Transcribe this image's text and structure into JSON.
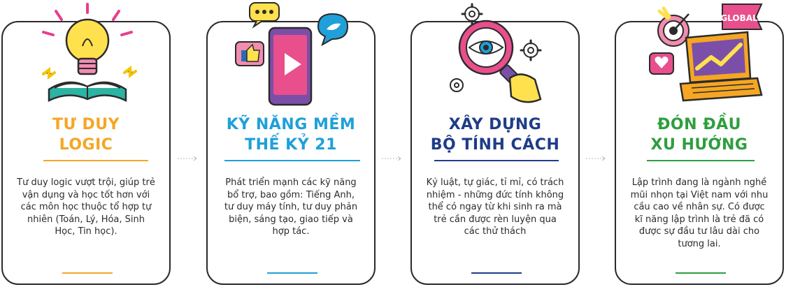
{
  "cards": [
    {
      "title_lines": [
        "TƯ DUY",
        "LOGIC"
      ],
      "description": "Tư duy logic vượt trội, giúp trẻ vận dụng và học tốt hơn với các môn học thuộc tổ hợp tự nhiên (Toán, Lý, Hóa, Sinh Học, Tin học).",
      "title_color": "#F5A623",
      "accent_color": "#F5A623",
      "icon": "lightbulb-book-icon"
    },
    {
      "title_lines": [
        "KỸ NĂNG MỀM",
        "THẾ KỶ 21"
      ],
      "description": "Phát triển mạnh các kỹ năng bổ trợ, bao gồm: Tiếng Anh, tư duy máy tính, tư duy phản biện, sáng tạo, giao tiếp và hợp tác.",
      "title_color": "#1FA0D8",
      "accent_color": "#1FA0D8",
      "icon": "smartphone-social-icon"
    },
    {
      "title_lines": [
        "XÂY DỰNG",
        "BỘ TÍNH CÁCH"
      ],
      "description": "Kỷ luật, tự giác, tỉ mỉ, có trách nhiệm - những đức tính không thể có ngay từ khi sinh ra mà trẻ cần được rèn luyện qua các thử thách",
      "title_color": "#1F3C88",
      "accent_color": "#1F3C88",
      "icon": "magnifier-eye-icon"
    },
    {
      "title_lines": [
        "ĐÓN ĐẦU",
        "XU HƯỚNG"
      ],
      "description": "Lập trình đang là ngành nghề mũi nhọn tại Việt nam với nhu cầu cao về nhân sự. Có được kĩ năng lập trình là trẻ đã có được sự đầu tư lâu dài cho tương lai.",
      "title_color": "#2E9E3E",
      "accent_color": "#2E9E3E",
      "icon": "laptop-global-icon",
      "badge_label": "GLOBAL"
    }
  ]
}
